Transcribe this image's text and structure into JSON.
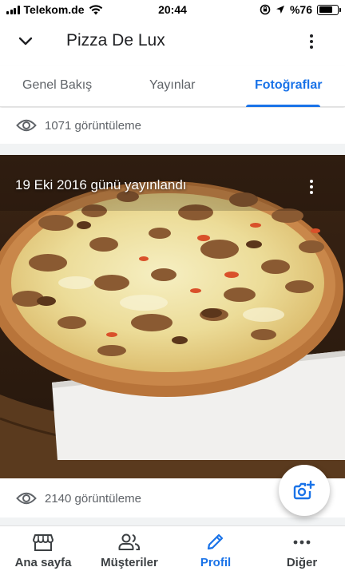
{
  "status_bar": {
    "carrier": "Telekom.de",
    "time": "20:44",
    "battery": "%76",
    "battery_level": 0.76
  },
  "app_bar": {
    "title": "Pizza De Lux"
  },
  "tabs": [
    {
      "label": "Genel Bakış",
      "active": false
    },
    {
      "label": "Yayınlar",
      "active": false
    },
    {
      "label": "Fotoğraflar",
      "active": true
    }
  ],
  "photos": [
    {
      "views": "1071 görüntüleme"
    },
    {
      "caption": "19 Eki 2016 günü yayınlandı",
      "views": "2140 görüntüleme"
    }
  ],
  "bottom_nav": [
    {
      "label": "Ana sayfa",
      "icon": "storefront-icon",
      "active": false
    },
    {
      "label": "Müşteriler",
      "icon": "people-icon",
      "active": false
    },
    {
      "label": "Profil",
      "icon": "pencil-icon",
      "active": true
    },
    {
      "label": "Diğer",
      "icon": "more-horiz-icon",
      "active": false
    }
  ],
  "colors": {
    "accent": "#1a73e8",
    "text": "#202124",
    "secondary_text": "#5f6368"
  }
}
